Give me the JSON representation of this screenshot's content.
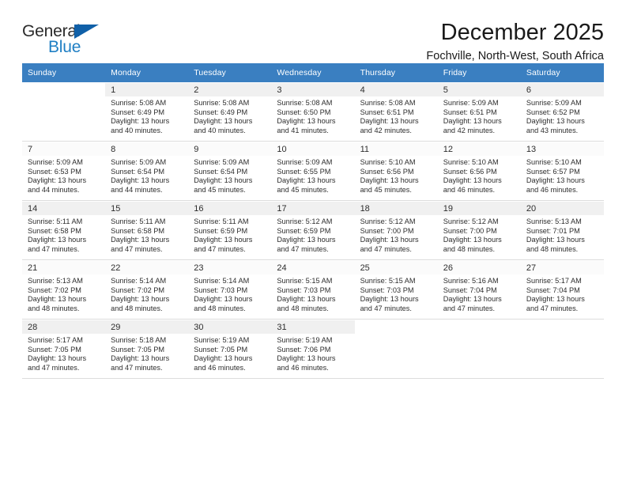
{
  "brand": {
    "name_top": "General",
    "name_bottom": "Blue",
    "triangle_icon": "triangle-icon",
    "color_dark": "#2b2b2b",
    "color_blue": "#1f7fc4",
    "color_triangle": "#1060a8"
  },
  "header": {
    "title": "December 2025",
    "location": "Fochville, North-West, South Africa"
  },
  "calendar": {
    "header_bg": "#3a7fc1",
    "header_text_color": "#ffffff",
    "weekday_headers": [
      "Sunday",
      "Monday",
      "Tuesday",
      "Wednesday",
      "Thursday",
      "Friday",
      "Saturday"
    ],
    "weeks": [
      [
        {
          "day": "",
          "sunrise": "",
          "sunset": "",
          "daylight_line1": "",
          "daylight_line2": ""
        },
        {
          "day": "1",
          "sunrise": "Sunrise: 5:08 AM",
          "sunset": "Sunset: 6:49 PM",
          "daylight_line1": "Daylight: 13 hours",
          "daylight_line2": "and 40 minutes."
        },
        {
          "day": "2",
          "sunrise": "Sunrise: 5:08 AM",
          "sunset": "Sunset: 6:49 PM",
          "daylight_line1": "Daylight: 13 hours",
          "daylight_line2": "and 40 minutes."
        },
        {
          "day": "3",
          "sunrise": "Sunrise: 5:08 AM",
          "sunset": "Sunset: 6:50 PM",
          "daylight_line1": "Daylight: 13 hours",
          "daylight_line2": "and 41 minutes."
        },
        {
          "day": "4",
          "sunrise": "Sunrise: 5:08 AM",
          "sunset": "Sunset: 6:51 PM",
          "daylight_line1": "Daylight: 13 hours",
          "daylight_line2": "and 42 minutes."
        },
        {
          "day": "5",
          "sunrise": "Sunrise: 5:09 AM",
          "sunset": "Sunset: 6:51 PM",
          "daylight_line1": "Daylight: 13 hours",
          "daylight_line2": "and 42 minutes."
        },
        {
          "day": "6",
          "sunrise": "Sunrise: 5:09 AM",
          "sunset": "Sunset: 6:52 PM",
          "daylight_line1": "Daylight: 13 hours",
          "daylight_line2": "and 43 minutes."
        }
      ],
      [
        {
          "day": "7",
          "sunrise": "Sunrise: 5:09 AM",
          "sunset": "Sunset: 6:53 PM",
          "daylight_line1": "Daylight: 13 hours",
          "daylight_line2": "and 44 minutes."
        },
        {
          "day": "8",
          "sunrise": "Sunrise: 5:09 AM",
          "sunset": "Sunset: 6:54 PM",
          "daylight_line1": "Daylight: 13 hours",
          "daylight_line2": "and 44 minutes."
        },
        {
          "day": "9",
          "sunrise": "Sunrise: 5:09 AM",
          "sunset": "Sunset: 6:54 PM",
          "daylight_line1": "Daylight: 13 hours",
          "daylight_line2": "and 45 minutes."
        },
        {
          "day": "10",
          "sunrise": "Sunrise: 5:09 AM",
          "sunset": "Sunset: 6:55 PM",
          "daylight_line1": "Daylight: 13 hours",
          "daylight_line2": "and 45 minutes."
        },
        {
          "day": "11",
          "sunrise": "Sunrise: 5:10 AM",
          "sunset": "Sunset: 6:56 PM",
          "daylight_line1": "Daylight: 13 hours",
          "daylight_line2": "and 45 minutes."
        },
        {
          "day": "12",
          "sunrise": "Sunrise: 5:10 AM",
          "sunset": "Sunset: 6:56 PM",
          "daylight_line1": "Daylight: 13 hours",
          "daylight_line2": "and 46 minutes."
        },
        {
          "day": "13",
          "sunrise": "Sunrise: 5:10 AM",
          "sunset": "Sunset: 6:57 PM",
          "daylight_line1": "Daylight: 13 hours",
          "daylight_line2": "and 46 minutes."
        }
      ],
      [
        {
          "day": "14",
          "sunrise": "Sunrise: 5:11 AM",
          "sunset": "Sunset: 6:58 PM",
          "daylight_line1": "Daylight: 13 hours",
          "daylight_line2": "and 47 minutes."
        },
        {
          "day": "15",
          "sunrise": "Sunrise: 5:11 AM",
          "sunset": "Sunset: 6:58 PM",
          "daylight_line1": "Daylight: 13 hours",
          "daylight_line2": "and 47 minutes."
        },
        {
          "day": "16",
          "sunrise": "Sunrise: 5:11 AM",
          "sunset": "Sunset: 6:59 PM",
          "daylight_line1": "Daylight: 13 hours",
          "daylight_line2": "and 47 minutes."
        },
        {
          "day": "17",
          "sunrise": "Sunrise: 5:12 AM",
          "sunset": "Sunset: 6:59 PM",
          "daylight_line1": "Daylight: 13 hours",
          "daylight_line2": "and 47 minutes."
        },
        {
          "day": "18",
          "sunrise": "Sunrise: 5:12 AM",
          "sunset": "Sunset: 7:00 PM",
          "daylight_line1": "Daylight: 13 hours",
          "daylight_line2": "and 47 minutes."
        },
        {
          "day": "19",
          "sunrise": "Sunrise: 5:12 AM",
          "sunset": "Sunset: 7:00 PM",
          "daylight_line1": "Daylight: 13 hours",
          "daylight_line2": "and 48 minutes."
        },
        {
          "day": "20",
          "sunrise": "Sunrise: 5:13 AM",
          "sunset": "Sunset: 7:01 PM",
          "daylight_line1": "Daylight: 13 hours",
          "daylight_line2": "and 48 minutes."
        }
      ],
      [
        {
          "day": "21",
          "sunrise": "Sunrise: 5:13 AM",
          "sunset": "Sunset: 7:02 PM",
          "daylight_line1": "Daylight: 13 hours",
          "daylight_line2": "and 48 minutes."
        },
        {
          "day": "22",
          "sunrise": "Sunrise: 5:14 AM",
          "sunset": "Sunset: 7:02 PM",
          "daylight_line1": "Daylight: 13 hours",
          "daylight_line2": "and 48 minutes."
        },
        {
          "day": "23",
          "sunrise": "Sunrise: 5:14 AM",
          "sunset": "Sunset: 7:03 PM",
          "daylight_line1": "Daylight: 13 hours",
          "daylight_line2": "and 48 minutes."
        },
        {
          "day": "24",
          "sunrise": "Sunrise: 5:15 AM",
          "sunset": "Sunset: 7:03 PM",
          "daylight_line1": "Daylight: 13 hours",
          "daylight_line2": "and 48 minutes."
        },
        {
          "day": "25",
          "sunrise": "Sunrise: 5:15 AM",
          "sunset": "Sunset: 7:03 PM",
          "daylight_line1": "Daylight: 13 hours",
          "daylight_line2": "and 47 minutes."
        },
        {
          "day": "26",
          "sunrise": "Sunrise: 5:16 AM",
          "sunset": "Sunset: 7:04 PM",
          "daylight_line1": "Daylight: 13 hours",
          "daylight_line2": "and 47 minutes."
        },
        {
          "day": "27",
          "sunrise": "Sunrise: 5:17 AM",
          "sunset": "Sunset: 7:04 PM",
          "daylight_line1": "Daylight: 13 hours",
          "daylight_line2": "and 47 minutes."
        }
      ],
      [
        {
          "day": "28",
          "sunrise": "Sunrise: 5:17 AM",
          "sunset": "Sunset: 7:05 PM",
          "daylight_line1": "Daylight: 13 hours",
          "daylight_line2": "and 47 minutes."
        },
        {
          "day": "29",
          "sunrise": "Sunrise: 5:18 AM",
          "sunset": "Sunset: 7:05 PM",
          "daylight_line1": "Daylight: 13 hours",
          "daylight_line2": "and 47 minutes."
        },
        {
          "day": "30",
          "sunrise": "Sunrise: 5:19 AM",
          "sunset": "Sunset: 7:05 PM",
          "daylight_line1": "Daylight: 13 hours",
          "daylight_line2": "and 46 minutes."
        },
        {
          "day": "31",
          "sunrise": "Sunrise: 5:19 AM",
          "sunset": "Sunset: 7:06 PM",
          "daylight_line1": "Daylight: 13 hours",
          "daylight_line2": "and 46 minutes."
        },
        {
          "day": "",
          "sunrise": "",
          "sunset": "",
          "daylight_line1": "",
          "daylight_line2": ""
        },
        {
          "day": "",
          "sunrise": "",
          "sunset": "",
          "daylight_line1": "",
          "daylight_line2": ""
        },
        {
          "day": "",
          "sunrise": "",
          "sunset": "",
          "daylight_line1": "",
          "daylight_line2": ""
        }
      ]
    ]
  }
}
